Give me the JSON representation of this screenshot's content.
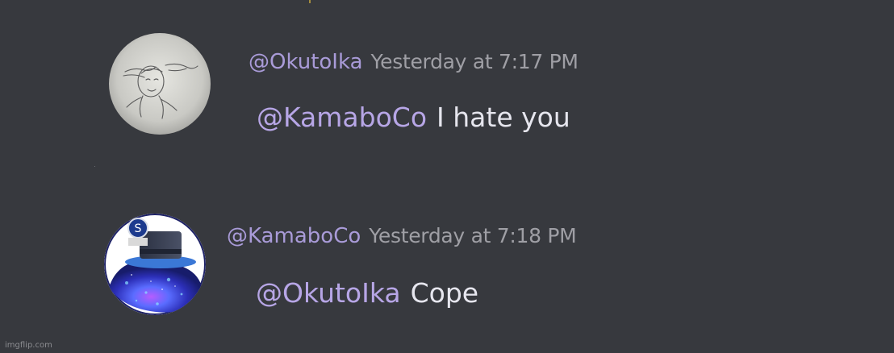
{
  "messages": [
    {
      "username": "@OkutoIka",
      "timestamp": "Yesterday at 7:17 PM",
      "mention": "@KamaboCo",
      "text": "I hate you",
      "avatar_icon": "sketch-avatar-icon"
    },
    {
      "username": "@KamaboCo",
      "timestamp": "Yesterday at 7:18 PM",
      "mention": "@OkutoIka",
      "text": "Cope",
      "avatar_icon": "galaxy-octopus-avatar-icon"
    }
  ],
  "watermark": "imgflip.com",
  "colors": {
    "background": "#37393e",
    "username": "#a99bd8",
    "timestamp": "#9f9fa5",
    "mention": "#b7a6e6",
    "message_text": "#e6e6ee"
  }
}
